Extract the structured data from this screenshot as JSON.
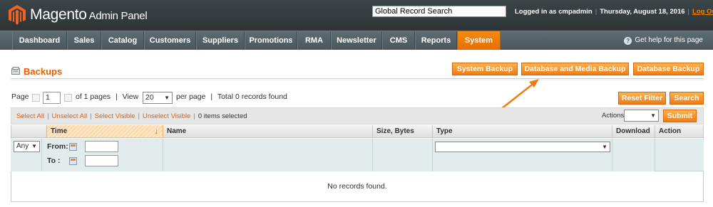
{
  "header": {
    "logo_main": "Magento",
    "logo_sub": "Admin Panel",
    "global_search_value": "Global Record Search",
    "logged_in": "Logged in as cmpadmin",
    "date": "Thursday, August 18, 2016",
    "logout": "Log Out"
  },
  "nav": {
    "items": [
      "Dashboard",
      "Sales",
      "Catalog",
      "Customers",
      "Suppliers",
      "Promotions",
      "RMA",
      "Newsletter",
      "CMS",
      "Reports",
      "System"
    ],
    "active": "System",
    "help": "Get help for this page"
  },
  "page": {
    "title": "Backups",
    "buttons": {
      "system_backup": "System Backup",
      "db_media_backup": "Database and Media Backup",
      "db_backup": "Database Backup",
      "reset_filter": "Reset Filter",
      "search": "Search",
      "submit": "Submit"
    }
  },
  "pager": {
    "page_label": "Page",
    "page_value": "1",
    "of_pages": "of 1 pages",
    "sep1": "|",
    "view_label": "View",
    "per_page_value": "20",
    "per_page_label": "per page",
    "sep2": "|",
    "total": "Total 0 records found"
  },
  "massaction": {
    "select_all": "Select All",
    "unselect_all": "Unselect All",
    "select_visible": "Select Visible",
    "unselect_visible": "Unselect Visible",
    "selected": "0 items selected",
    "actions_label": "Actions"
  },
  "grid": {
    "columns": [
      "Time",
      "Name",
      "Size, Bytes",
      "Type",
      "Download",
      "Action"
    ],
    "sort_arrow": "↓",
    "any_select": "Any",
    "from_label": "From:",
    "to_label": "To :",
    "empty": "No records found."
  },
  "colors": {
    "accent": "#eb5e00",
    "header_bg": "#3b4548",
    "nav_bg": "#5e6d72",
    "button": "#f18200"
  }
}
